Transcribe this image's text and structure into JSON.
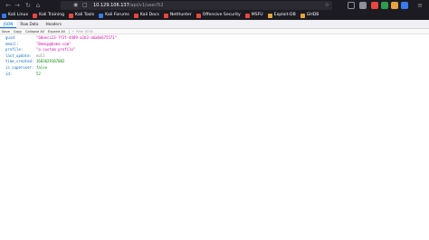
{
  "browser": {
    "url_host": "10.129.106.137",
    "url_path": "/api/v1/user/52",
    "icons": {
      "back": "arrow-left-icon",
      "forward": "arrow-right-icon",
      "reload": "reload-icon",
      "home": "home-icon",
      "security": "shield-icon",
      "page": "page-icon",
      "bookmark": "star-icon"
    }
  },
  "bookmarks": [
    {
      "label": "Kali Linux",
      "color": "#367bf0"
    },
    {
      "label": "Kali Training",
      "color": "#e8473f"
    },
    {
      "label": "Kali Tools",
      "color": "#e8473f"
    },
    {
      "label": "Kali Forums",
      "color": "#367bf0"
    },
    {
      "label": "Kali Docs",
      "color": "#e8473f"
    },
    {
      "label": "NetHunter",
      "color": "#e8473f"
    },
    {
      "label": "Offensive Security",
      "color": "#e8473f"
    },
    {
      "label": "MSFU",
      "color": "#e8473f"
    },
    {
      "label": "Exploit-DB",
      "color": "#e8a33f"
    },
    {
      "label": "GHDB",
      "color": "#e8a33f"
    }
  ],
  "viewer": {
    "tabs": [
      "JSON",
      "Raw Data",
      "Headers"
    ],
    "actions": [
      "Save",
      "Copy",
      "Collapse All",
      "Expand All"
    ],
    "filter_placeholder": "Filter JSON",
    "rows": [
      {
        "key": "guid:",
        "value": "\"60aecc23-7f3f-4489-a1b3-a6a8e675571\"",
        "type": "string"
      },
      {
        "key": "email:",
        "value": "\"Bemsp@bsme.com\"",
        "type": "string"
      },
      {
        "key": "profile:",
        "value": "\"a custom profile\"",
        "type": "string"
      },
      {
        "key": "last_update:",
        "value": "null",
        "type": "null"
      },
      {
        "key": "time_created:",
        "value": "1683629187882",
        "type": "num"
      },
      {
        "key": "is_superuser:",
        "value": "false",
        "type": "bool"
      },
      {
        "key": "id:",
        "value": "52",
        "type": "num"
      }
    ]
  },
  "colors": {
    "toolbar_bg": "#1c1b22",
    "url_bg": "#2b2a33",
    "key": "#0b6ebf",
    "string": "#dd00a9",
    "number": "#058b00",
    "active_tab": "#0074e8"
  }
}
